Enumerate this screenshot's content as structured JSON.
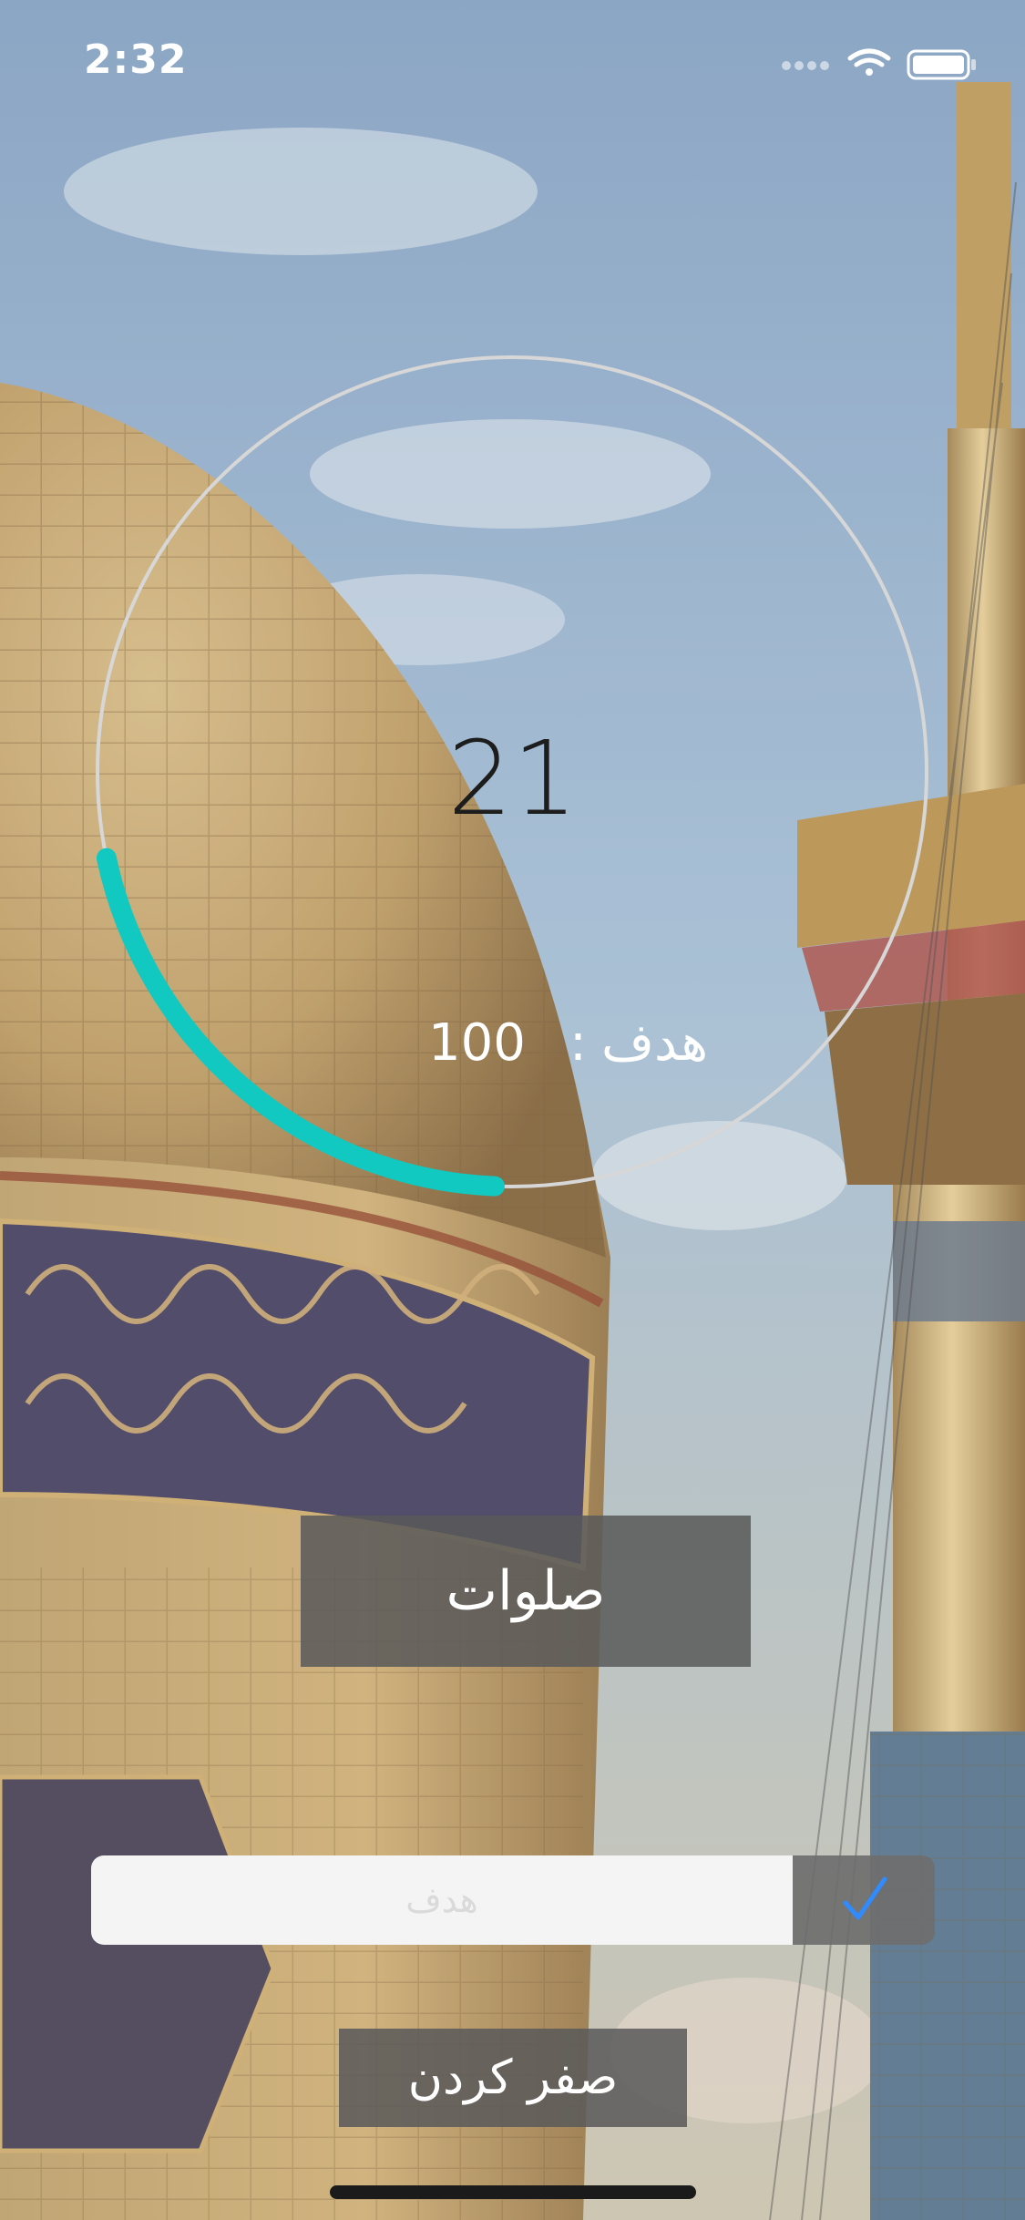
{
  "status_bar": {
    "time": "2:32",
    "icons": [
      "signal-dots-icon",
      "wifi-icon",
      "battery-icon"
    ]
  },
  "counter": {
    "count": "21",
    "goal_label": "هدف",
    "goal_separator": ":",
    "goal_value": "100",
    "progress_fraction": 0.21,
    "progress_color": "#11c9c0",
    "ring_color": "#d7d7d7"
  },
  "actions": {
    "salavat_button": "صلوات",
    "goal_input_placeholder": "هدف",
    "confirm_icon": "checkmark-icon",
    "confirm_color": "#2f8bff",
    "reset_button": "صفر کردن"
  }
}
